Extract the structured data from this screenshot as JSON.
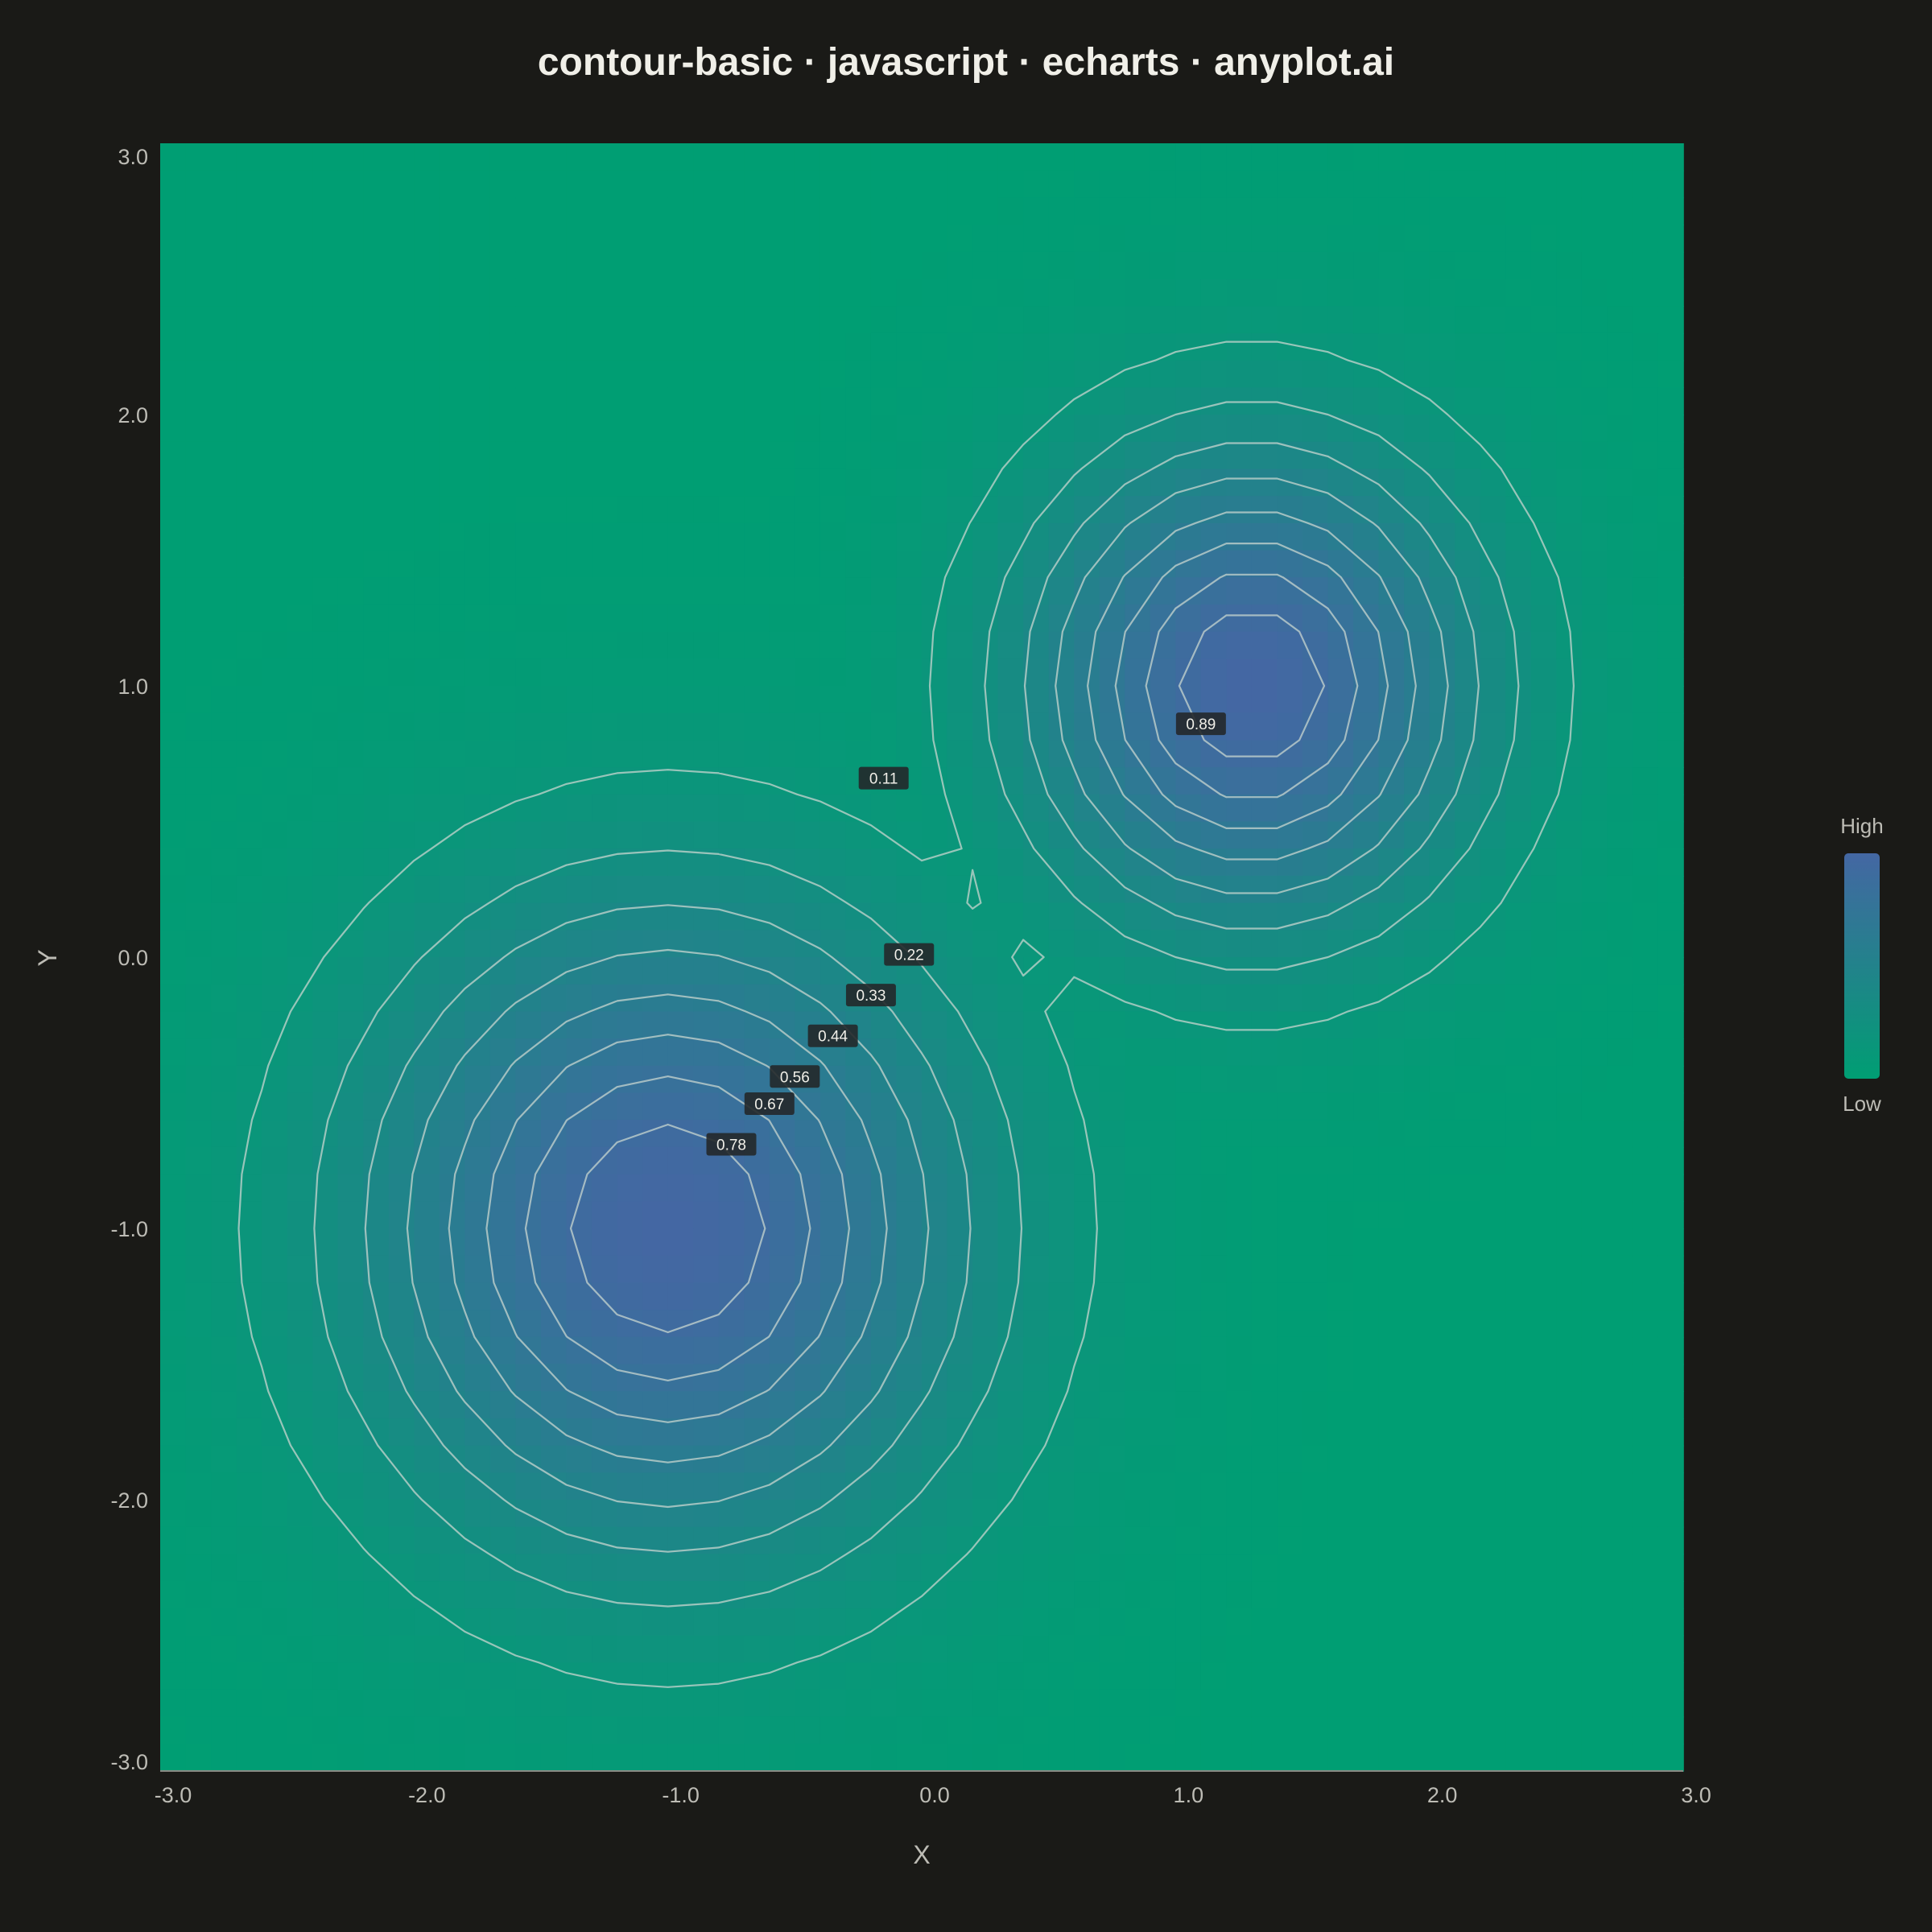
{
  "chart_data": {
    "type": "heatmap",
    "subtype": "contour",
    "title": "contour-basic · javascript · echarts · anyplot.ai",
    "xlabel": "X",
    "ylabel": "Y",
    "xlim": [
      -3.0,
      3.0
    ],
    "ylim": [
      -3.0,
      3.0
    ],
    "x_ticks": [
      "-3.0",
      "-2.0",
      "-1.0",
      "0.0",
      "1.0",
      "2.0",
      "3.0"
    ],
    "y_ticks": [
      "3.0",
      "2.0",
      "1.0",
      "0.0",
      "-1.0",
      "-2.0",
      "-3.0"
    ],
    "grid": false,
    "peaks": [
      {
        "x": -1.0,
        "y": -1.0,
        "sigma": 0.8,
        "amplitude": 1.0
      },
      {
        "x": 1.3,
        "y": 1.0,
        "sigma": 0.6,
        "amplitude": 1.0
      }
    ],
    "contour_levels": [
      0.11,
      0.22,
      0.33,
      0.44,
      0.56,
      0.67,
      0.78,
      0.89
    ],
    "contour_labels": [
      {
        "text": "0.11",
        "x": -0.15,
        "y": 0.66
      },
      {
        "text": "0.22",
        "x": -0.05,
        "y": 0.01
      },
      {
        "text": "0.33",
        "x": -0.2,
        "y": -0.14
      },
      {
        "text": "0.44",
        "x": -0.35,
        "y": -0.29
      },
      {
        "text": "0.56",
        "x": -0.5,
        "y": -0.44
      },
      {
        "text": "0.67",
        "x": -0.6,
        "y": -0.54
      },
      {
        "text": "0.78",
        "x": -0.75,
        "y": -0.69
      },
      {
        "text": "0.89",
        "x": 1.1,
        "y": 0.86
      }
    ],
    "visual_map": {
      "high_label": "High",
      "low_label": "Low",
      "high_color": "#4467a3",
      "low_color": "#009e73",
      "placement": "right"
    },
    "colors": {
      "background": "#1a1a17",
      "contour_line": "#c8d6cf",
      "label_bg": "#23282a",
      "text": "#f0efe8",
      "axis_text": "#bdbcb5"
    }
  }
}
